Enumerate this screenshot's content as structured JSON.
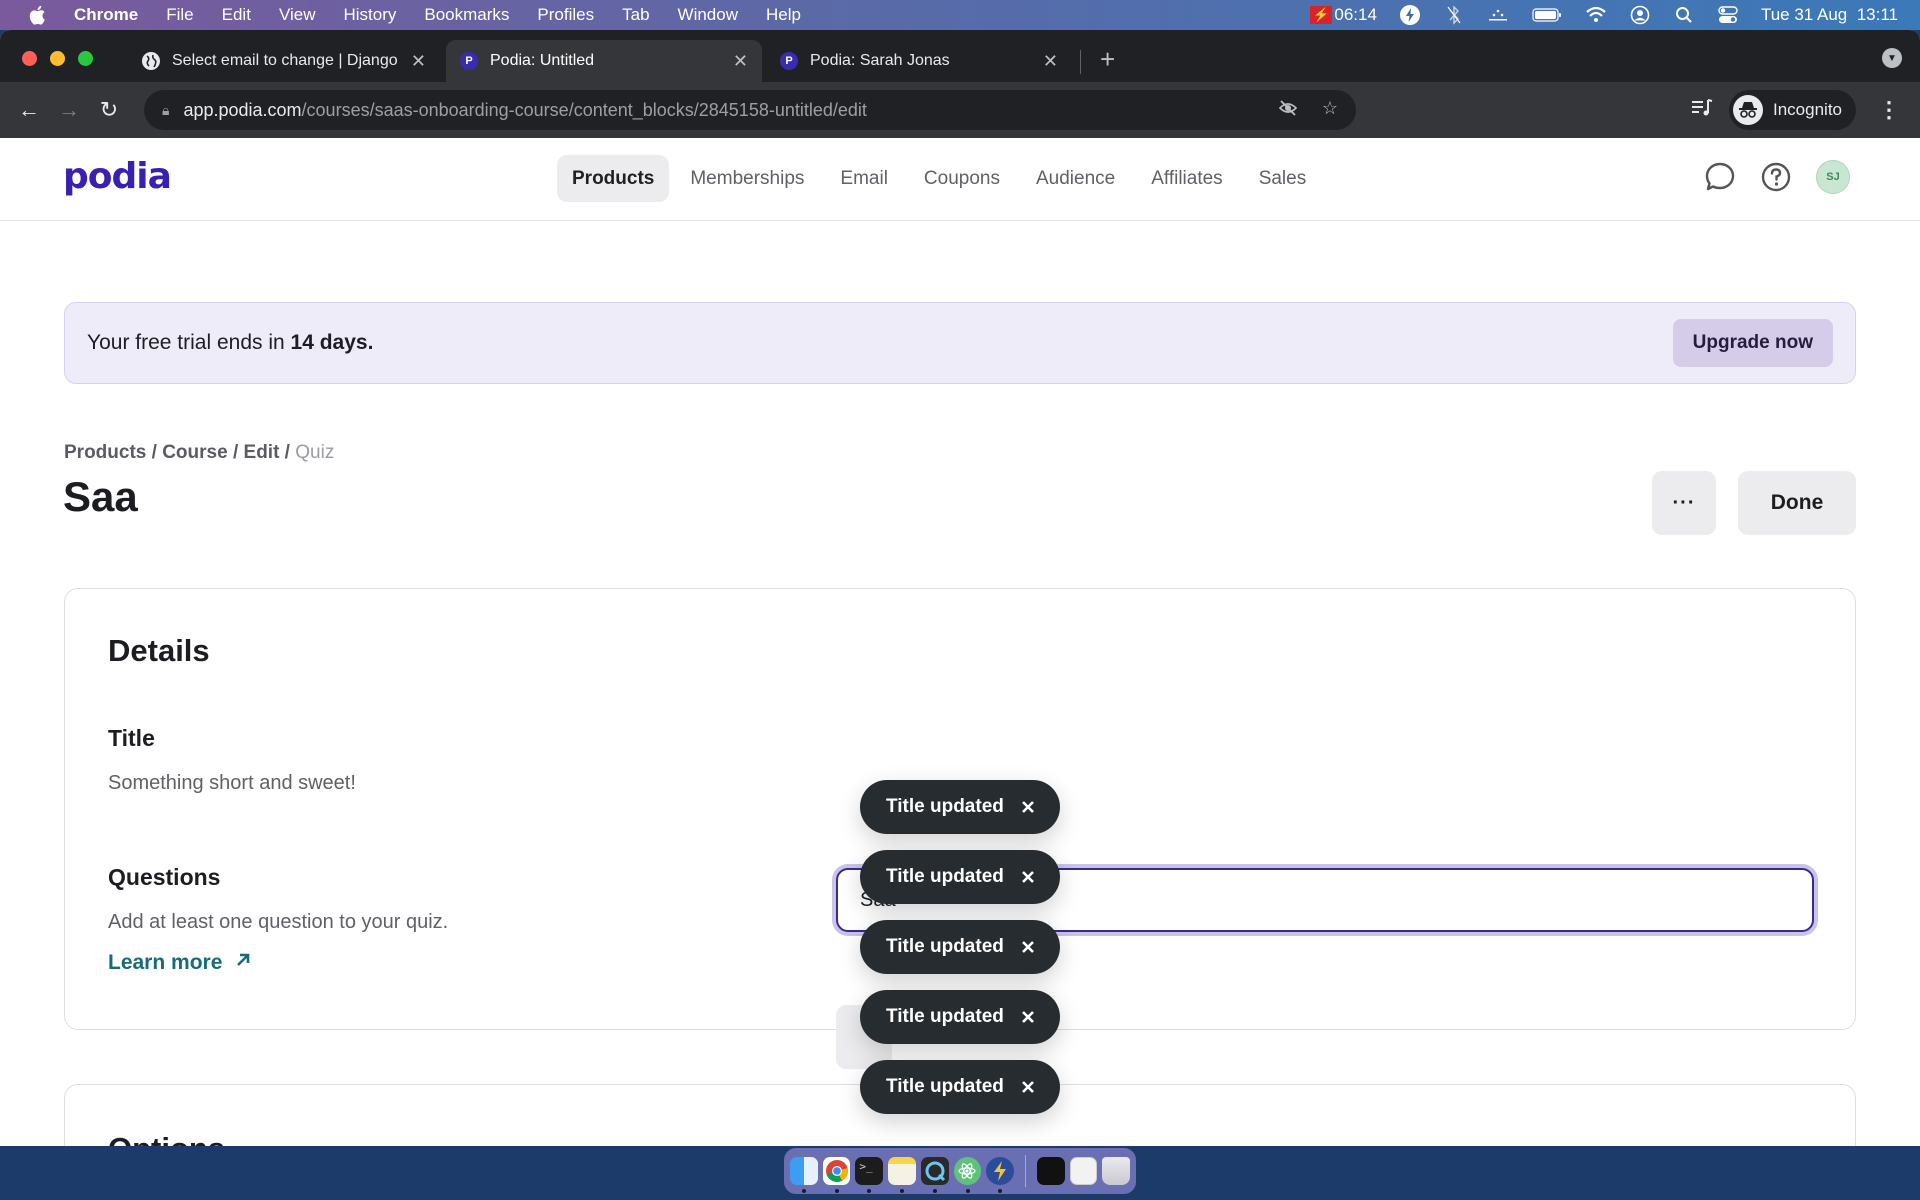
{
  "menubar": {
    "app": "Chrome",
    "items": [
      "File",
      "Edit",
      "View",
      "History",
      "Bookmarks",
      "Profiles",
      "Tab",
      "Window",
      "Help"
    ],
    "recording_time": "06:14",
    "datetime": "Tue 31 Aug  13:11"
  },
  "browser": {
    "tabs": [
      {
        "title": "Select email to change | Django",
        "favicon": "globe-icon",
        "active": false
      },
      {
        "title": "Podia: Untitled",
        "favicon": "P",
        "active": true
      },
      {
        "title": "Podia: Sarah Jonas",
        "favicon": "P",
        "active": false
      }
    ],
    "url_host": "app.podia.com",
    "url_path": "/courses/saas-onboarding-course/content_blocks/2845158-untitled/edit",
    "profile_label": "Incognito"
  },
  "app": {
    "logo": "podia",
    "nav": [
      {
        "label": "Products",
        "active": true
      },
      {
        "label": "Memberships",
        "active": false
      },
      {
        "label": "Email",
        "active": false
      },
      {
        "label": "Coupons",
        "active": false
      },
      {
        "label": "Audience",
        "active": false
      },
      {
        "label": "Affiliates",
        "active": false
      },
      {
        "label": "Sales",
        "active": false
      }
    ],
    "avatar_initials": "SJ"
  },
  "trial": {
    "prefix": "Your free trial ends in ",
    "days": "14 days.",
    "upgrade_label": "Upgrade now"
  },
  "header": {
    "breadcrumb": [
      "Products",
      "Course",
      "Edit"
    ],
    "breadcrumb_current": "Quiz",
    "separator": " / ",
    "title": "Saa",
    "more_label": "···",
    "done_label": "Done"
  },
  "details": {
    "heading": "Details",
    "title_label": "Title",
    "title_desc": "Something short and sweet!",
    "title_value": "Saa",
    "questions_label": "Questions",
    "questions_desc": "Add at least one question to your quiz.",
    "learn_more": "Learn more"
  },
  "options": {
    "heading": "Options"
  },
  "toasts": [
    {
      "text": "Title updated"
    },
    {
      "text": "Title updated"
    },
    {
      "text": "Title updated"
    },
    {
      "text": "Title updated"
    },
    {
      "text": "Title updated"
    }
  ],
  "dock": {
    "apps": [
      "Finder",
      "Chrome",
      "Terminal",
      "Notes",
      "QuickTime",
      "Atom",
      "Reeder"
    ],
    "others": [
      "Screen recording",
      "Screenshot",
      "Trash"
    ]
  },
  "colors": {
    "brand": "#3a1fb0",
    "toast_bg": "#272c30",
    "trial_bg": "#efecfa",
    "link": "#186b78"
  }
}
